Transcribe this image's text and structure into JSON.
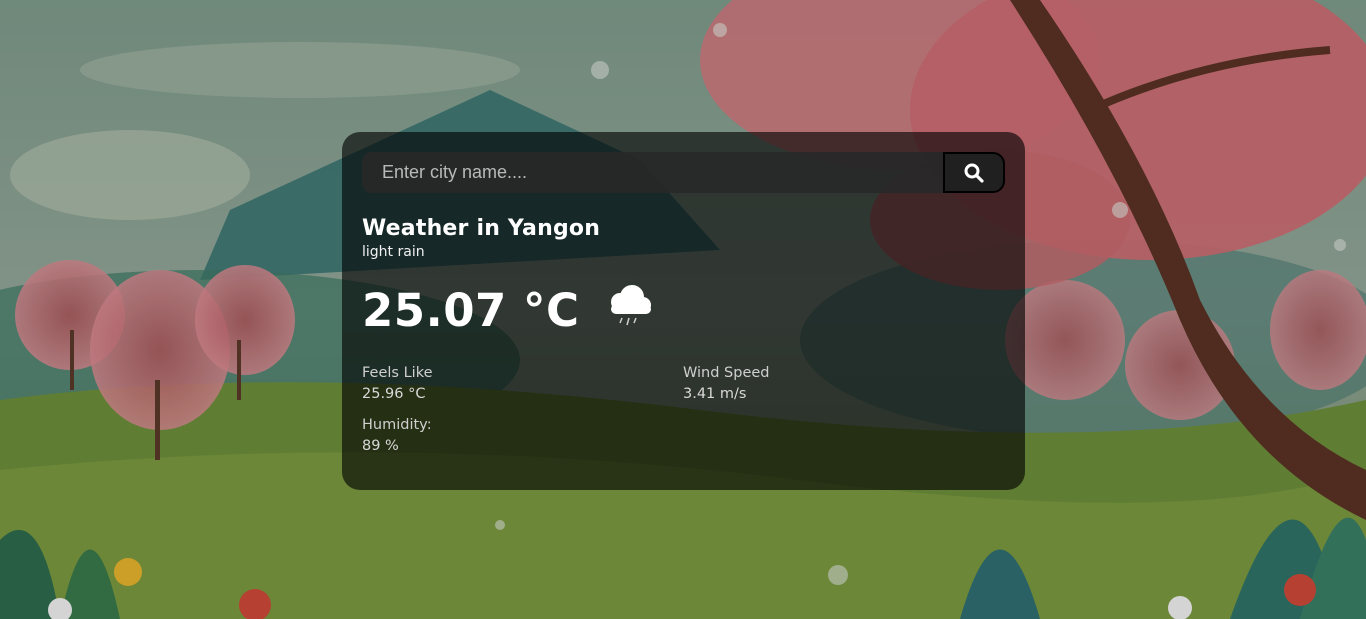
{
  "search": {
    "placeholder": "Enter city name....",
    "value": ""
  },
  "weather": {
    "title": "Weather in Yangon",
    "description": "light rain",
    "temperature": "25.07 °C",
    "icon": "cloud-rain-icon"
  },
  "details": {
    "feels_like_label": "Feels Like",
    "feels_like_value": "25.96 °C",
    "wind_speed_label": "Wind Speed",
    "wind_speed_value": "3.41 m/s",
    "humidity_label": "Humidity:",
    "humidity_value": "89 %"
  },
  "colors": {
    "card_bg": "rgba(0,0,0,0.62)",
    "text": "#ffffff",
    "input_bg": "#282828"
  }
}
